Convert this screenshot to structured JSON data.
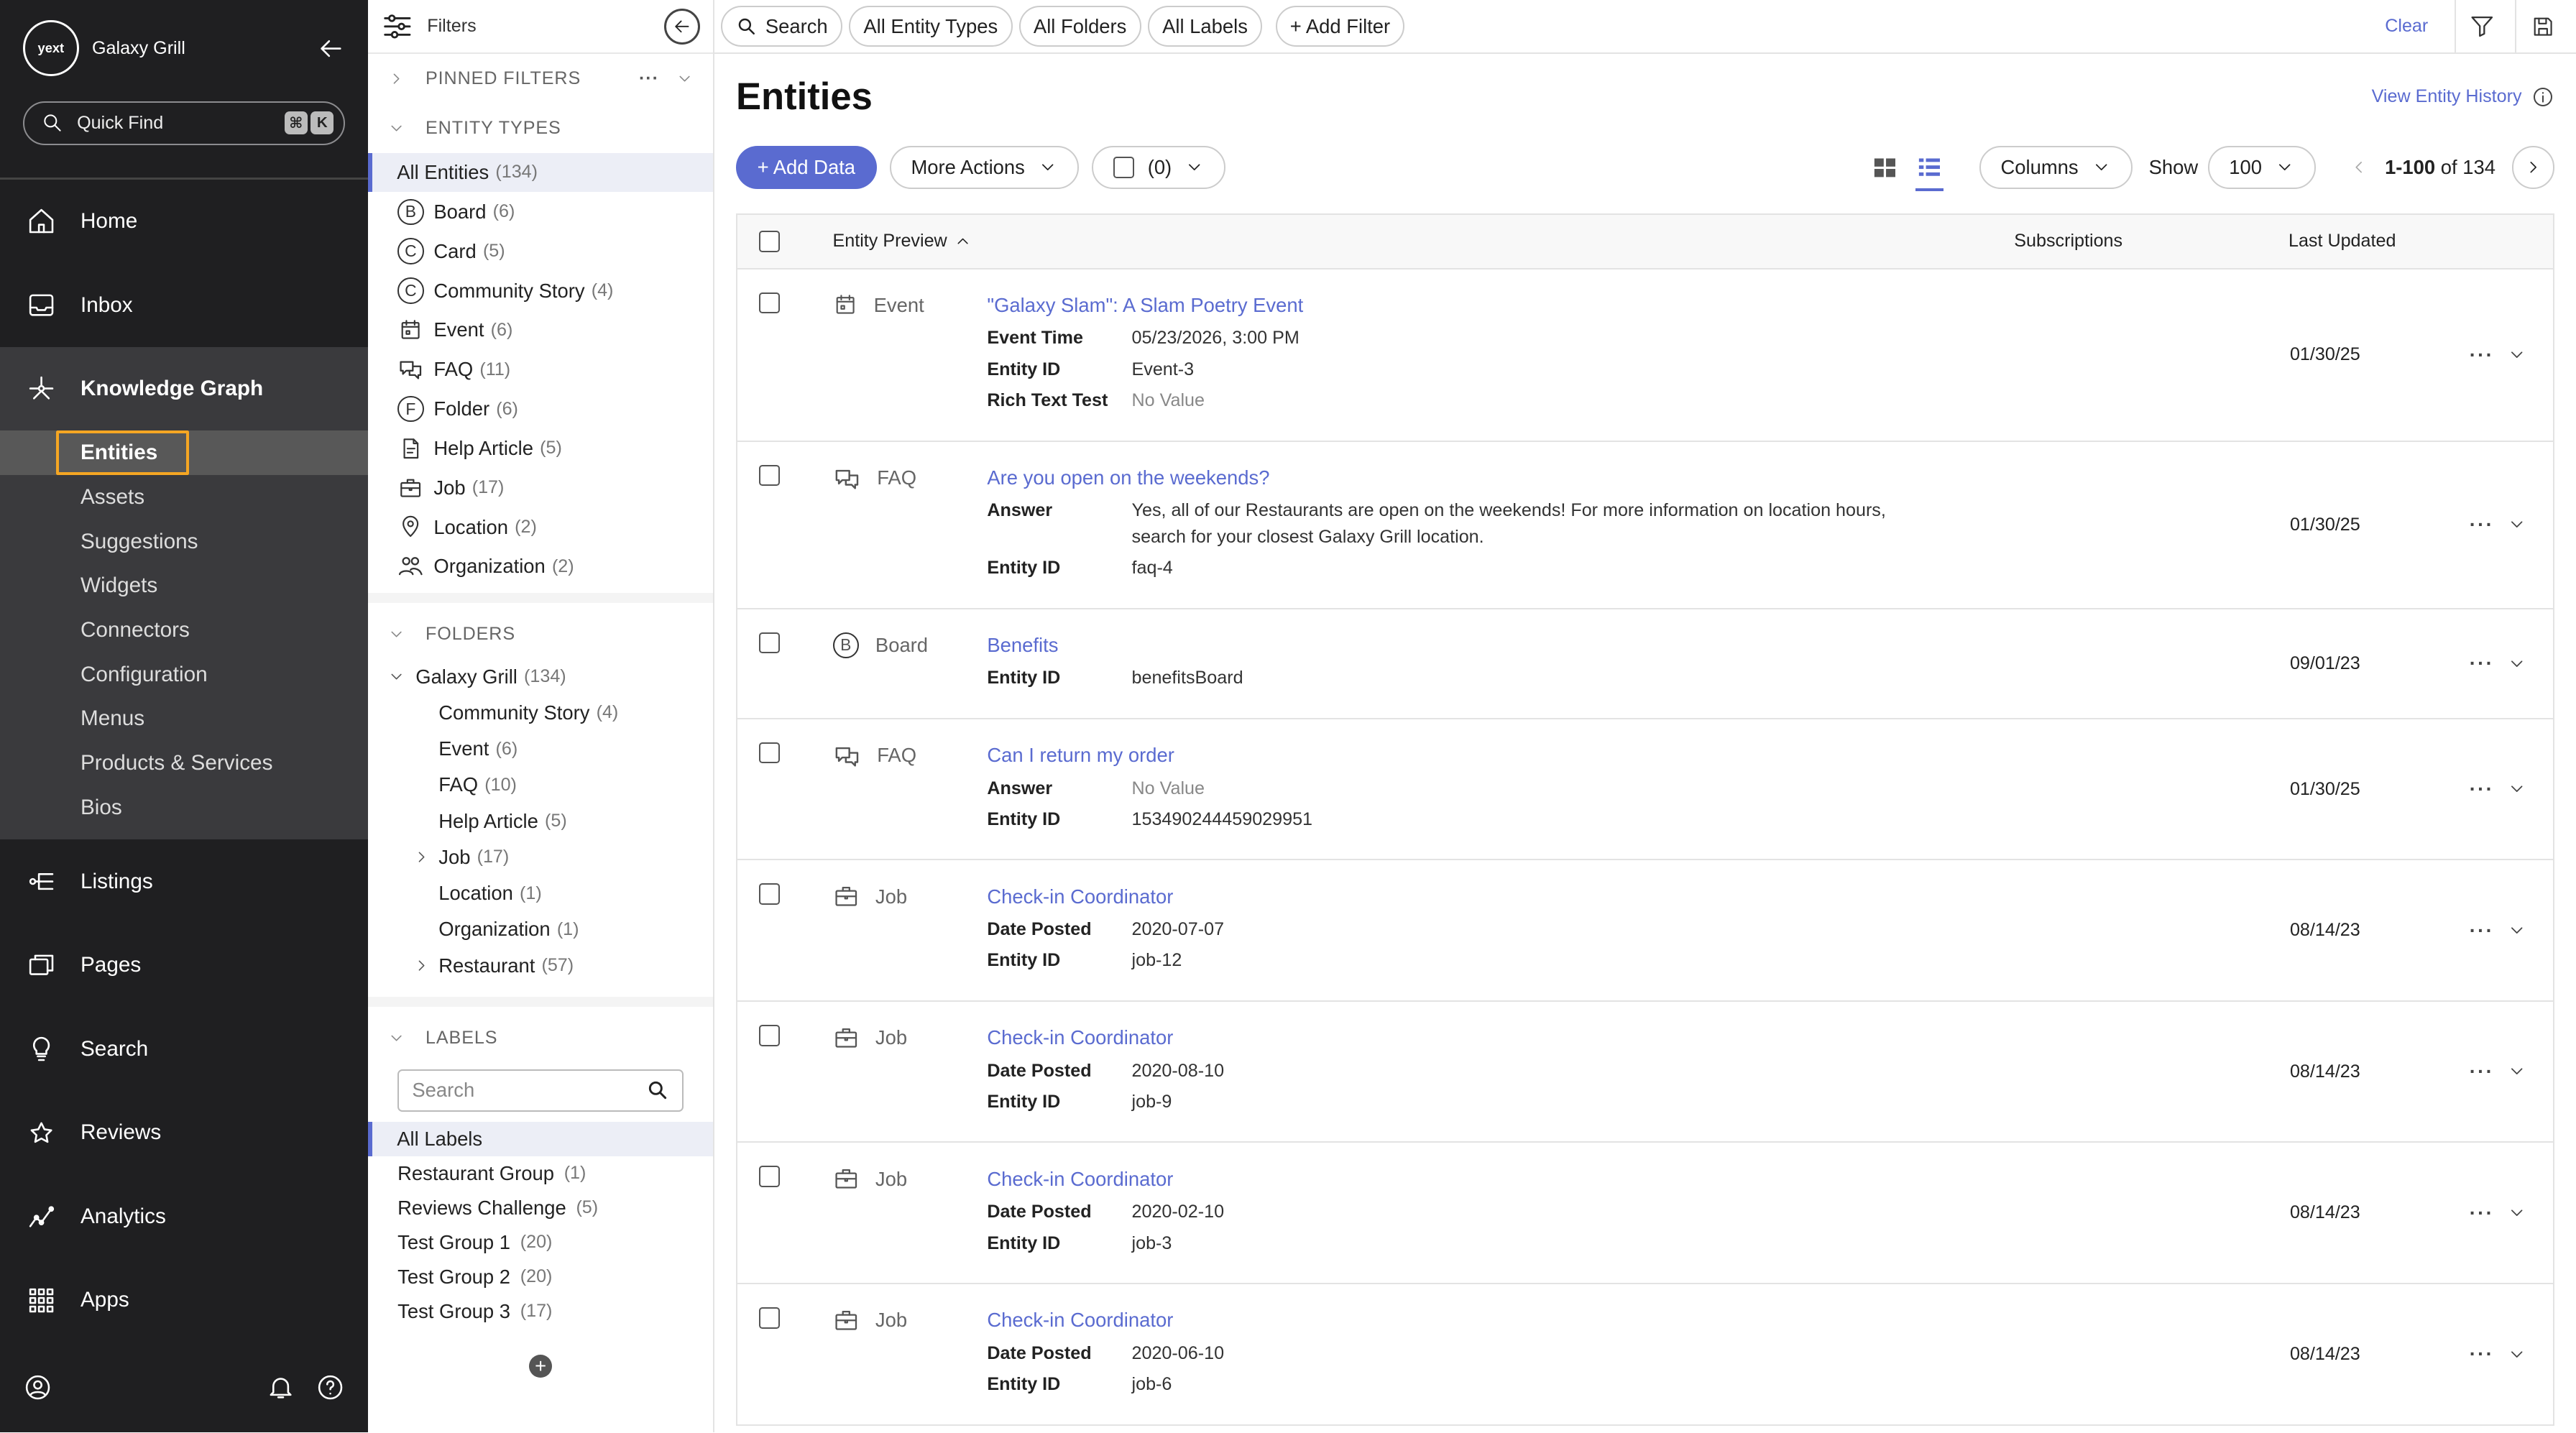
{
  "sidebar": {
    "logo": "yext",
    "org": "Galaxy Grill",
    "quickfind": "Quick Find",
    "kbd": [
      "⌘",
      "K"
    ],
    "nav_top": [
      {
        "label": "Home",
        "icon": "home-icon"
      },
      {
        "label": "Inbox",
        "icon": "inbox-icon"
      }
    ],
    "kg": {
      "label": "Knowledge Graph",
      "icon": "knowledge-graph-icon"
    },
    "kg_sub": [
      "Entities",
      "Assets",
      "Suggestions",
      "Widgets",
      "Connectors",
      "Configuration",
      "Menus",
      "Products & Services",
      "Bios"
    ],
    "nav_bottom": [
      {
        "label": "Listings",
        "icon": "listings-icon"
      },
      {
        "label": "Pages",
        "icon": "pages-icon"
      },
      {
        "label": "Search",
        "icon": "search-bulb-icon"
      },
      {
        "label": "Reviews",
        "icon": "reviews-icon"
      },
      {
        "label": "Analytics",
        "icon": "analytics-icon"
      },
      {
        "label": "Apps",
        "icon": "apps-grid-icon"
      }
    ]
  },
  "filters": {
    "title": "Filters",
    "pinned": "PINNED FILTERS",
    "entity_types_h": "ENTITY TYPES",
    "entity_types": [
      {
        "label": "All Entities",
        "count": "(134)"
      },
      {
        "label": "Board",
        "count": "(6)",
        "letter": "B"
      },
      {
        "label": "Card",
        "count": "(5)",
        "letter": "C"
      },
      {
        "label": "Community Story",
        "count": "(4)",
        "letter": "C"
      },
      {
        "label": "Event",
        "count": "(6)"
      },
      {
        "label": "FAQ",
        "count": "(11)"
      },
      {
        "label": "Folder",
        "count": "(6)",
        "letter": "F"
      },
      {
        "label": "Help Article",
        "count": "(5)"
      },
      {
        "label": "Job",
        "count": "(17)"
      },
      {
        "label": "Location",
        "count": "(2)"
      },
      {
        "label": "Organization",
        "count": "(2)"
      }
    ],
    "folders_h": "FOLDERS",
    "folder_root": {
      "label": "Galaxy Grill",
      "count": "(134)"
    },
    "folders": [
      {
        "label": "Community Story",
        "count": "(4)"
      },
      {
        "label": "Event",
        "count": "(6)"
      },
      {
        "label": "FAQ",
        "count": "(10)"
      },
      {
        "label": "Help Article",
        "count": "(5)"
      },
      {
        "label": "Job",
        "count": "(17)"
      },
      {
        "label": "Location",
        "count": "(1)"
      },
      {
        "label": "Organization",
        "count": "(1)"
      },
      {
        "label": "Restaurant",
        "count": "(57)"
      }
    ],
    "labels_h": "LABELS",
    "labels_search": "Search",
    "labels": [
      {
        "label": "All Labels",
        "count": ""
      },
      {
        "label": "Restaurant Group",
        "count": "(1)"
      },
      {
        "label": "Reviews Challenge",
        "count": "(5)"
      },
      {
        "label": "Test Group 1",
        "count": "(20)"
      },
      {
        "label": "Test Group 2",
        "count": "(20)"
      },
      {
        "label": "Test Group 3",
        "count": "(17)"
      }
    ],
    "add": "+"
  },
  "topbar": {
    "chips": [
      "Search",
      "All Entity Types",
      "All Folders",
      "All Labels",
      "+ Add Filter"
    ],
    "clear": "Clear"
  },
  "main": {
    "title": "Entities",
    "history": "View Entity History",
    "add_data": "+ Add Data",
    "more_actions": "More Actions",
    "selected": "(0)",
    "columns": "Columns",
    "show": "Show",
    "show_val": "100",
    "range": "1-100",
    "of": "of 134",
    "cols": [
      "Entity Preview",
      "Subscriptions",
      "Last Updated"
    ]
  },
  "rows": [
    {
      "type": "Event",
      "icon": "event-icon",
      "name": "\"Galaxy Slam\": A Slam Poetry Event",
      "fields": [
        {
          "k": "Event Time",
          "v": "05/23/2026, 3:00 PM"
        },
        {
          "k": "Entity ID",
          "v": "Event-3"
        },
        {
          "k": "Rich Text Test",
          "v": "No Value"
        }
      ],
      "date": "01/30/25",
      "h": 105
    },
    {
      "type": "FAQ",
      "icon": "faq-icon",
      "name": "Are you open on the weekends?",
      "fields": [
        {
          "k": "Answer",
          "v": "Yes, all of our Restaurants are open on the weekends! For more information on location hours, search for your closest Galaxy Grill location."
        },
        {
          "k": "Entity ID",
          "v": "faq-4"
        }
      ],
      "date": "01/30/25",
      "h": 102
    },
    {
      "type": "Board",
      "icon": "board-icon",
      "name": "Benefits",
      "fields": [
        {
          "k": "Entity ID",
          "v": "benefitsBoard"
        }
      ],
      "date": "09/01/23",
      "h": 67
    },
    {
      "type": "FAQ",
      "icon": "faq-icon",
      "name": "Can I return my order",
      "fields": [
        {
          "k": "Answer",
          "v": "No Value"
        },
        {
          "k": "Entity ID",
          "v": "153490244459029951"
        }
      ],
      "date": "01/30/25",
      "h": 86
    },
    {
      "type": "Job",
      "icon": "job-icon",
      "name": "Check-in Coordinator",
      "fields": [
        {
          "k": "Date Posted",
          "v": "2020-07-07"
        },
        {
          "k": "Entity ID",
          "v": "job-12"
        }
      ],
      "date": "08/14/23",
      "h": 86
    },
    {
      "type": "Job",
      "icon": "job-icon",
      "name": "Check-in Coordinator",
      "fields": [
        {
          "k": "Date Posted",
          "v": "2020-08-10"
        },
        {
          "k": "Entity ID",
          "v": "job-9"
        }
      ],
      "date": "08/14/23",
      "h": 86
    },
    {
      "type": "Job",
      "icon": "job-icon",
      "name": "Check-in Coordinator",
      "fields": [
        {
          "k": "Date Posted",
          "v": "2020-02-10"
        },
        {
          "k": "Entity ID",
          "v": "job-3"
        }
      ],
      "date": "08/14/23",
      "h": 86
    },
    {
      "type": "Job",
      "icon": "job-icon",
      "name": "Check-in Coordinator",
      "fields": [
        {
          "k": "Date Posted",
          "v": "2020-06-10"
        },
        {
          "k": "Entity ID",
          "v": "job-6"
        }
      ],
      "date": "08/14/23",
      "h": 86
    }
  ]
}
